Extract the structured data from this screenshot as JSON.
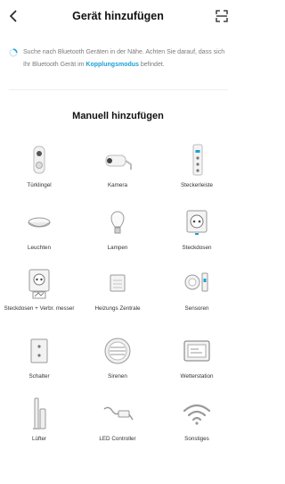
{
  "header": {
    "title": "Gerät hinzufügen"
  },
  "notice": {
    "text_before": "Suche nach Bluetooth Geräten in der Nähe. Achten Sie darauf, dass sich Ihr Bluetooth Gerät im ",
    "link": "Kopplungsmodus",
    "text_after": " befindet."
  },
  "section": {
    "title": "Manuell hinzufügen"
  },
  "devices": [
    {
      "label": "Türklingel",
      "icon": "doorbell-icon"
    },
    {
      "label": "Kamera",
      "icon": "camera-icon"
    },
    {
      "label": "Steckerleiste",
      "icon": "power-strip-icon"
    },
    {
      "label": "Leuchten",
      "icon": "ceiling-light-icon"
    },
    {
      "label": "Lampen",
      "icon": "bulb-icon"
    },
    {
      "label": "Steckdosen",
      "icon": "socket-icon"
    },
    {
      "label": "Steckdosen + Verbr. messer",
      "icon": "socket-meter-icon"
    },
    {
      "label": "Heizungs Zentrale",
      "icon": "heating-hub-icon"
    },
    {
      "label": "Sensoren",
      "icon": "sensor-icon"
    },
    {
      "label": "Schalter",
      "icon": "switch-icon"
    },
    {
      "label": "Sirenen",
      "icon": "siren-icon"
    },
    {
      "label": "Wetterstation",
      "icon": "weather-station-icon"
    },
    {
      "label": "Lüfter",
      "icon": "fan-icon"
    },
    {
      "label": "LED Controller",
      "icon": "led-controller-icon"
    },
    {
      "label": "Sonstiges",
      "icon": "wifi-icon"
    }
  ],
  "colors": {
    "accent": "#1a9fd6",
    "text_muted": "#7a7a7a"
  }
}
